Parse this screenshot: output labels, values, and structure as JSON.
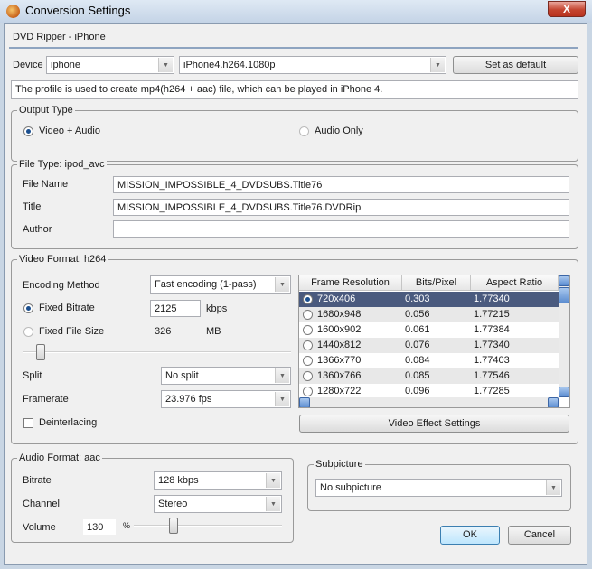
{
  "window": {
    "title": "Conversion Settings",
    "close": "X"
  },
  "header": {
    "heading": "DVD Ripper - iPhone"
  },
  "device": {
    "label": "Device",
    "device_value": "iphone",
    "profile_value": "iPhone4.h264.1080p",
    "set_default": "Set as default"
  },
  "description": "The profile is used to create mp4(h264 + aac) file, which can be played in iPhone 4.",
  "output_type": {
    "legend": "Output Type",
    "options": [
      {
        "label": "Video + Audio",
        "selected": true
      },
      {
        "label": "Audio Only",
        "selected": false
      }
    ]
  },
  "file_type": {
    "legend": "File Type: ipod_avc",
    "file_name_label": "File Name",
    "file_name": "MISSION_IMPOSSIBLE_4_DVDSUBS.Title76",
    "title_label": "Title",
    "title": "MISSION_IMPOSSIBLE_4_DVDSUBS.Title76.DVDRip",
    "author_label": "Author",
    "author": ""
  },
  "video_format": {
    "legend": "Video Format: h264",
    "encoding_label": "Encoding Method",
    "encoding_value": "Fast encoding (1-pass)",
    "fixed_bitrate_label": "Fixed Bitrate",
    "bitrate_value": "2125",
    "bitrate_unit": "kbps",
    "fixed_size_label": "Fixed File Size",
    "size_value": "326",
    "size_unit": "MB",
    "quality_slider": 0.05,
    "split_label": "Split",
    "split_value": "No split",
    "framerate_label": "Framerate",
    "framerate_value": "23.976 fps",
    "deinterlacing_label": "Deinterlacing",
    "effect_button": "Video Effect Settings",
    "table": {
      "headers": [
        "Frame Resolution",
        "Bits/Pixel",
        "Aspect Ratio"
      ],
      "rows": [
        {
          "res": "720x406",
          "bpp": "0.303",
          "ar": "1.77340",
          "selected": true
        },
        {
          "res": "1680x948",
          "bpp": "0.056",
          "ar": "1.77215"
        },
        {
          "res": "1600x902",
          "bpp": "0.061",
          "ar": "1.77384"
        },
        {
          "res": "1440x812",
          "bpp": "0.076",
          "ar": "1.77340"
        },
        {
          "res": "1366x770",
          "bpp": "0.084",
          "ar": "1.77403"
        },
        {
          "res": "1360x766",
          "bpp": "0.085",
          "ar": "1.77546"
        },
        {
          "res": "1280x722",
          "bpp": "0.096",
          "ar": "1.77285"
        }
      ]
    }
  },
  "audio_format": {
    "legend": "Audio Format: aac",
    "bitrate_label": "Bitrate",
    "bitrate_value": "128 kbps",
    "channel_label": "Channel",
    "channel_value": "Stereo",
    "volume_label": "Volume",
    "volume_value": "130",
    "volume_unit": "%"
  },
  "subpicture": {
    "legend": "Subpicture",
    "value": "No subpicture"
  },
  "buttons": {
    "ok": "OK",
    "cancel": "Cancel"
  }
}
